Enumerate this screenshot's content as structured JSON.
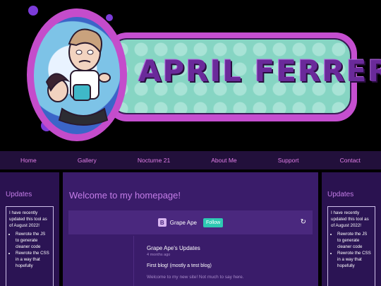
{
  "banner": {
    "title": "APRIL FERRERO",
    "colors": {
      "pill": "#c54fd0",
      "pill_fill": "#86d5c3",
      "title": "#6a2a9a"
    }
  },
  "nav": {
    "items": [
      "Home",
      "Gallery",
      "Nocturne 21",
      "About Me",
      "Support",
      "Contact"
    ]
  },
  "left_sidebar": {
    "title": "Updates",
    "intro": "I have recently updated this tool as of August 2022!",
    "bullets": [
      "Rewrote the JS to generate cleaner code",
      "Rewrote the CSS in a way that hopefully"
    ]
  },
  "right_sidebar": {
    "title": "Updates",
    "intro": "I have recently updated this tool as of August 2022!",
    "bullets": [
      "Rewrote the JS to generate cleaner code",
      "Rewrote the CSS in a way that hopefully"
    ]
  },
  "main": {
    "title": "Welcome to my homepage!",
    "blog": {
      "icon_letter": "B",
      "name": "Grape Ape",
      "follow_label": "Follow",
      "refresh_icon": "refresh-icon",
      "post": {
        "author_title": "Grape Ape's Updates",
        "time": "4 months ago",
        "title": "First blog! (mostly a test blog)",
        "excerpt": "Welcome to my new site! Not much to say here."
      }
    }
  }
}
